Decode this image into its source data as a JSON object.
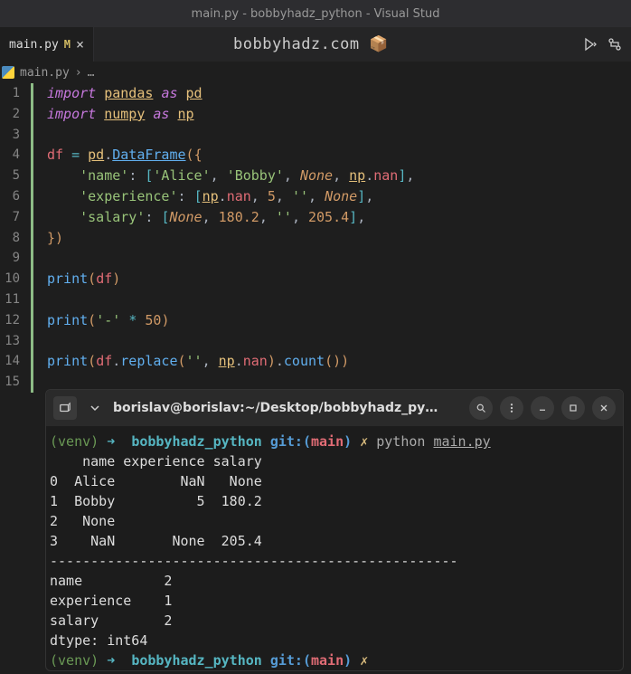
{
  "window": {
    "title": "main.py - bobbyhadz_python - Visual Stud"
  },
  "tab": {
    "filename": "main.py",
    "modified_indicator": "M",
    "close_symbol": "×"
  },
  "watermark": {
    "text": "bobbyhadz.com 📦"
  },
  "breadcrumb": {
    "file": "main.py",
    "sep": "›",
    "more": "…"
  },
  "editor": {
    "line_numbers": [
      "1",
      "2",
      "3",
      "4",
      "5",
      "6",
      "7",
      "8",
      "9",
      "10",
      "11",
      "12",
      "13",
      "14",
      "15"
    ],
    "tokens": {
      "import": "import",
      "pandas": "pandas",
      "as": "as",
      "pd": "pd",
      "numpy": "numpy",
      "np": "np",
      "df": "df",
      "eq": "=",
      "dot": ".",
      "DataFrame": "DataFrame",
      "lp": "(",
      "rp": ")",
      "lb": "{",
      "rb": "}",
      "ls": "[",
      "rs": "]",
      "colon": ":",
      "comma": ",",
      "name": "'name'",
      "Alice": "'Alice'",
      "Bobby": "'Bobby'",
      "None": "None",
      "nan": "nan",
      "experience": "'experience'",
      "five": "5",
      "empty": "''",
      "salary": "'salary'",
      "n180": "180.2",
      "n205": "205.4",
      "print": "print",
      "dash": "'-'",
      "star": "*",
      "fifty": "50",
      "replace": "replace",
      "count": "count"
    }
  },
  "terminal": {
    "title": "borislav@borislav:~/Desktop/bobbyhadz_py…",
    "prompt": {
      "venv": "(venv)",
      "arrow": "➜",
      "dir": "bobbyhadz_python",
      "git": "git:(",
      "branch": "main",
      "gitclose": ")",
      "dirty": "✗"
    },
    "command": {
      "python": "python",
      "file": "main.py"
    },
    "output": [
      "    name experience salary",
      "0  Alice        NaN   None",
      "1  Bobby          5  180.2",
      "2   None                  ",
      "3    NaN       None  205.4",
      "--------------------------------------------------",
      "name          2",
      "experience    1",
      "salary        2",
      "dtype: int64"
    ]
  }
}
